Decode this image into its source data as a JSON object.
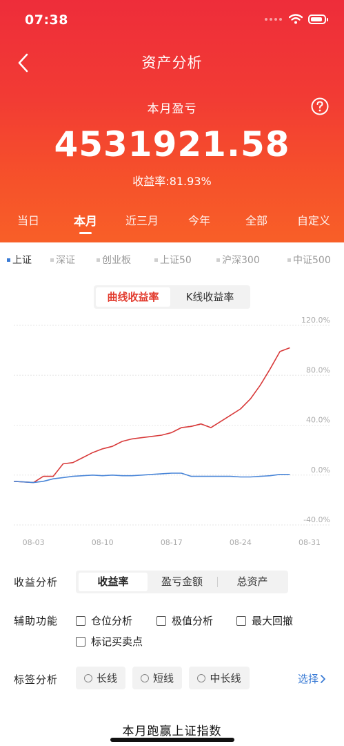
{
  "status_bar": {
    "time": "07:38"
  },
  "nav": {
    "title": "资产分析",
    "back_icon": "chevron-left-icon",
    "help_icon": "question-circle-icon"
  },
  "summary": {
    "label": "本月盈亏",
    "amount": "4531921.58",
    "rate_text": "收益率:81.93%"
  },
  "period_tabs": [
    {
      "label": "当日",
      "active": false
    },
    {
      "label": "本月",
      "active": true
    },
    {
      "label": "近三月",
      "active": false
    },
    {
      "label": "今年",
      "active": false
    },
    {
      "label": "全部",
      "active": false
    },
    {
      "label": "自定义",
      "active": false
    }
  ],
  "index_tabs": [
    {
      "label": "上证",
      "active": true
    },
    {
      "label": "深证",
      "active": false
    },
    {
      "label": "创业板",
      "active": false
    },
    {
      "label": "上证50",
      "active": false
    },
    {
      "label": "沪深300",
      "active": false
    },
    {
      "label": "中证500",
      "active": false
    }
  ],
  "chart_mode": {
    "options": [
      "曲线收益率",
      "K线收益率"
    ],
    "active": 0
  },
  "chart_data": {
    "type": "line",
    "x_ticks": [
      "08-03",
      "08-10",
      "08-17",
      "08-24",
      "08-31"
    ],
    "y_ticks": [
      "120.0%",
      "80.0%",
      "40.0%",
      "0.0%",
      "-40.0%"
    ],
    "ylim": [
      -40,
      120
    ],
    "xlim": [
      "08-01",
      "08-31"
    ],
    "grid": true,
    "series": [
      {
        "color": "#d83a3a",
        "x": [
          "08-01",
          "08-02",
          "08-03",
          "08-04",
          "08-05",
          "08-06",
          "08-07",
          "08-08",
          "08-09",
          "08-10",
          "08-11",
          "08-12",
          "08-13",
          "08-14",
          "08-15",
          "08-16",
          "08-17",
          "08-18",
          "08-19",
          "08-20",
          "08-21",
          "08-22",
          "08-23",
          "08-24",
          "08-25",
          "08-26",
          "08-27",
          "08-28",
          "08-29"
        ],
        "values": [
          -5,
          -5.5,
          -6,
          -1,
          -1,
          9,
          10,
          14,
          18,
          21,
          23,
          27,
          29,
          30,
          31,
          32,
          34,
          38,
          39,
          41,
          38,
          43,
          48,
          53,
          61,
          72,
          85,
          99,
          102
        ]
      },
      {
        "color": "#4a86d8",
        "x": [
          "08-01",
          "08-02",
          "08-03",
          "08-04",
          "08-05",
          "08-06",
          "08-07",
          "08-08",
          "08-09",
          "08-10",
          "08-11",
          "08-12",
          "08-13",
          "08-14",
          "08-15",
          "08-16",
          "08-17",
          "08-18",
          "08-19",
          "08-20",
          "08-21",
          "08-22",
          "08-23",
          "08-24",
          "08-25",
          "08-26",
          "08-27",
          "08-28",
          "08-29"
        ],
        "values": [
          -5,
          -5.5,
          -6,
          -5,
          -3,
          -2,
          -1,
          -0.5,
          0,
          -0.5,
          0,
          -0.5,
          -0.5,
          0,
          0.5,
          1,
          1.5,
          1.5,
          -1,
          -1,
          -1,
          -1,
          -1,
          -1.5,
          -1.5,
          -1,
          -0.5,
          0.5,
          0.5
        ]
      }
    ]
  },
  "profit_analysis": {
    "label": "收益分析",
    "options": [
      "收益率",
      "盈亏金额",
      "总资产"
    ],
    "active": 0
  },
  "aux": {
    "label": "辅助功能",
    "checkboxes": [
      "仓位分析",
      "极值分析",
      "最大回撤",
      "标记买卖点"
    ]
  },
  "tag_analysis": {
    "label": "标签分析",
    "options": [
      "长线",
      "短线",
      "中长线"
    ],
    "select_label": "选择"
  },
  "footer": {
    "text": "本月跑赢上证指数"
  }
}
